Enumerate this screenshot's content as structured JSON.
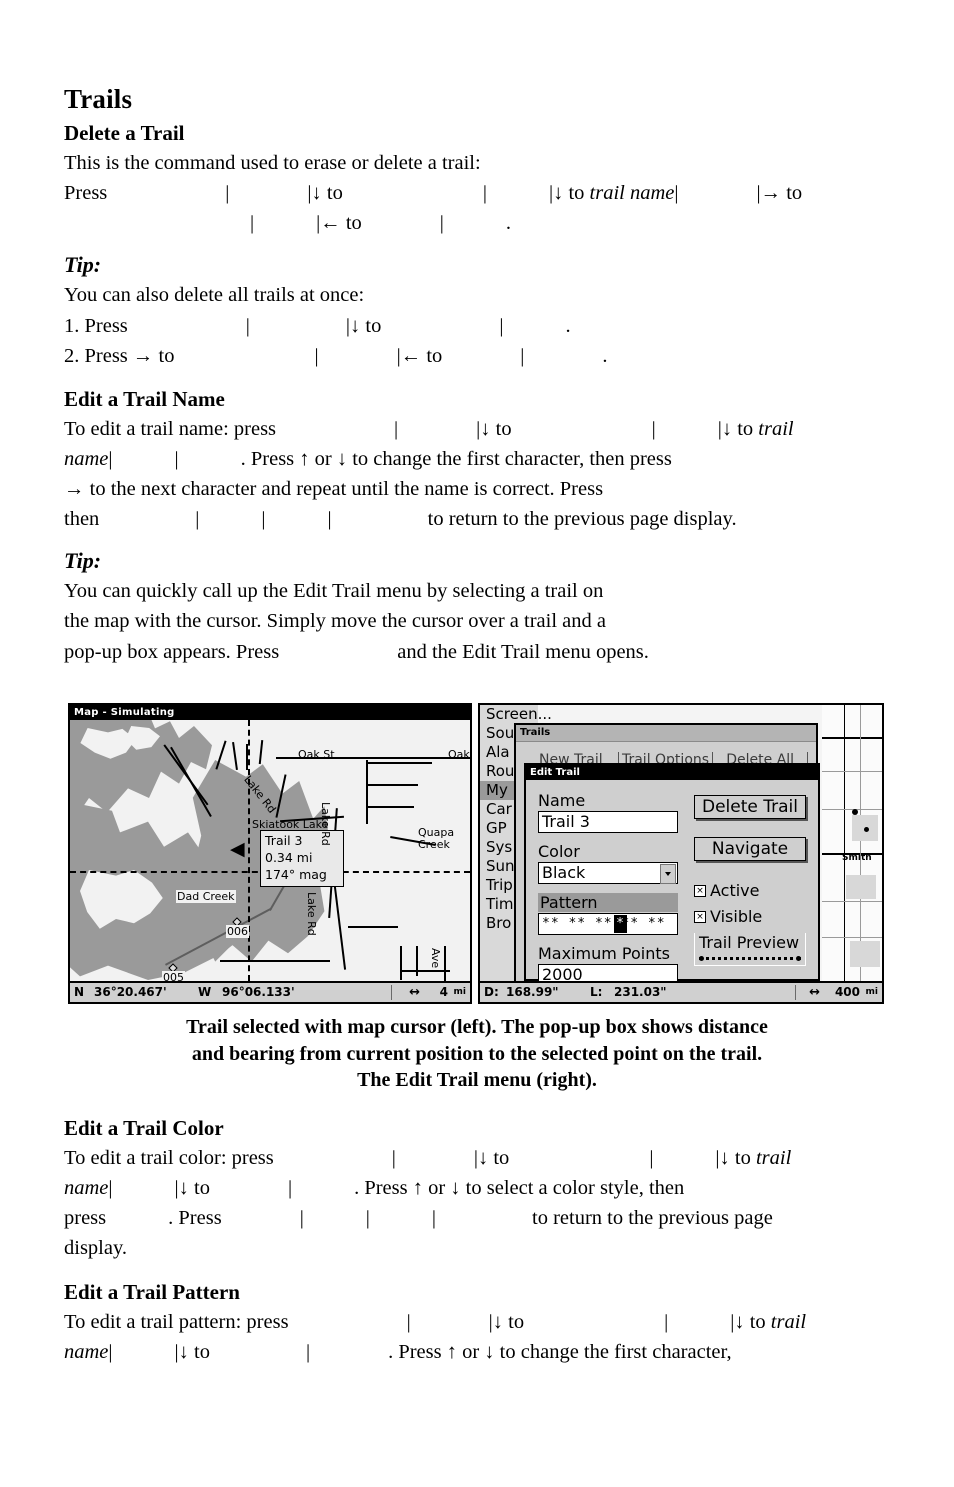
{
  "document": {
    "chapter_title": "Trails",
    "sections": [
      {
        "heading": "Delete a Trail",
        "intro": "This is the command used to erase or delete a trail:",
        "line1_a": "Press",
        "line1_b": "to",
        "line1_c": "to",
        "line1_d": "trail name",
        "line1_e": "to",
        "line2_a": "to",
        "line2_period": "."
      },
      {
        "heading": "Tip:",
        "tip_intro": "You can also delete all trails at once:",
        "item1_num": "1. Press",
        "item1_to": "to",
        "item1_period": ".",
        "item2_num": "2. Press",
        "item2_arrow": "→",
        "item2_to": "to",
        "item2_to2": "to",
        "item2_period": "."
      },
      {
        "heading": "Edit a Trail Name",
        "t1": "To edit a trail name: press",
        "t2": "to",
        "t3": "to",
        "t4": "trail",
        "t5": "name",
        "t6": ". Press ↑ or ↓ to change the first character, then press",
        "t7": "→ to the next character and repeat until the name is correct. Press",
        "t8": "then",
        "t9": "to return to the previous page display."
      },
      {
        "heading": "Tip:",
        "tip_line1": "You can quickly call up the Edit Trail menu by selecting a trail on",
        "tip_line2": "the map with the cursor. Simply move the cursor over a trail and a",
        "tip_line3_a": "pop-up box appears. Press",
        "tip_line3_b": "and the Edit Trail menu opens."
      },
      {
        "heading": "Edit a Trail Color",
        "c1": "To edit a trail color: press",
        "c2": "to",
        "c3": "to",
        "c4": "trail",
        "c5": "name",
        "c6": "to",
        "c7": ". Press ↑ or ↓ to select a color style, then",
        "c8": "press",
        "c9": ". Press",
        "c10": "to return to the previous page",
        "c11": "display."
      },
      {
        "heading": "Edit a Trail Pattern",
        "p1": "To edit a trail pattern: press",
        "p2": "to",
        "p3": "to",
        "p4": "trail",
        "p5": "name",
        "p6": "to",
        "p7": ". Press ↑ or ↓ to change the first character,"
      }
    ],
    "figure_caption_line1": "Trail selected with map cursor (left). The pop-up box shows distance",
    "figure_caption_line2": "and bearing from current position to the selected point on the trail.",
    "figure_caption_line3": "The Edit Trail menu (right)."
  },
  "map_screenshot": {
    "titlebar": "Map - Simulating",
    "popup": {
      "name": "Trail 3",
      "distance": "0.34 mi",
      "bearing": "174° mag"
    },
    "labels": [
      {
        "text": "Oak St"
      },
      {
        "text": "Oak"
      },
      {
        "text": "Lake Rd"
      },
      {
        "text": "Skiatook Lake"
      },
      {
        "text": "Lake Rd"
      },
      {
        "text": "Quapa"
      },
      {
        "text": "Creek"
      },
      {
        "text": "Dad Creek"
      },
      {
        "text": "Lake Rd"
      },
      {
        "text": "Ave"
      }
    ],
    "waypoints": [
      "006",
      "005"
    ],
    "status": {
      "lat_hemisphere": "N",
      "latitude": "36°20.467'",
      "lon_hemisphere": "W",
      "longitude": "96°06.133'",
      "range_icon": "↔",
      "range": "4",
      "range_unit": "mi"
    }
  },
  "menu_screenshot": {
    "background_menu": [
      {
        "label": "Screen...",
        "selected": false
      },
      {
        "label": "Sou",
        "selected": false
      },
      {
        "label": "Ala",
        "selected": false
      },
      {
        "label": "Rou",
        "selected": false
      },
      {
        "label": "My",
        "selected": true
      },
      {
        "label": "Car",
        "selected": false
      },
      {
        "label": "GP",
        "selected": false
      },
      {
        "label": "Sys",
        "selected": false
      },
      {
        "label": "Sun",
        "selected": false
      },
      {
        "label": "Trip",
        "selected": false
      },
      {
        "label": "Tim",
        "selected": false
      },
      {
        "label": "Bro",
        "selected": false
      }
    ],
    "trails_window": {
      "title": "Trails",
      "buttons": [
        "New Trail",
        "Trail Options",
        "Delete All"
      ]
    },
    "edit_trail_window": {
      "title": "Edit Trail",
      "name_label": "Name",
      "name_value": "Trail 3",
      "color_label": "Color",
      "color_value": "Black",
      "pattern_label": "Pattern",
      "pattern_value": "**  **  **  **  **",
      "pattern_cursor": "*",
      "max_points_label": "Maximum Points",
      "max_points_value": "2000",
      "delete_button": "Delete Trail",
      "navigate_button": "Navigate",
      "active_label": "Active",
      "active_checked": "×",
      "visible_label": "Visible",
      "visible_checked": "×",
      "preview_label": "Trail Preview"
    },
    "map_labels": [
      "Smith"
    ],
    "status": {
      "d_label": "D:",
      "d_value": "168.99\"",
      "l_label": "L:",
      "l_value": "231.03\"",
      "range_icon": "↔",
      "range": "400",
      "range_unit": "mi"
    }
  },
  "colors": {
    "land": "#9a9a9a",
    "water": "#f2f2f2",
    "dialog": "#cfcfcf",
    "titlebar": "#000000",
    "highlight": "#9a9a9a"
  }
}
